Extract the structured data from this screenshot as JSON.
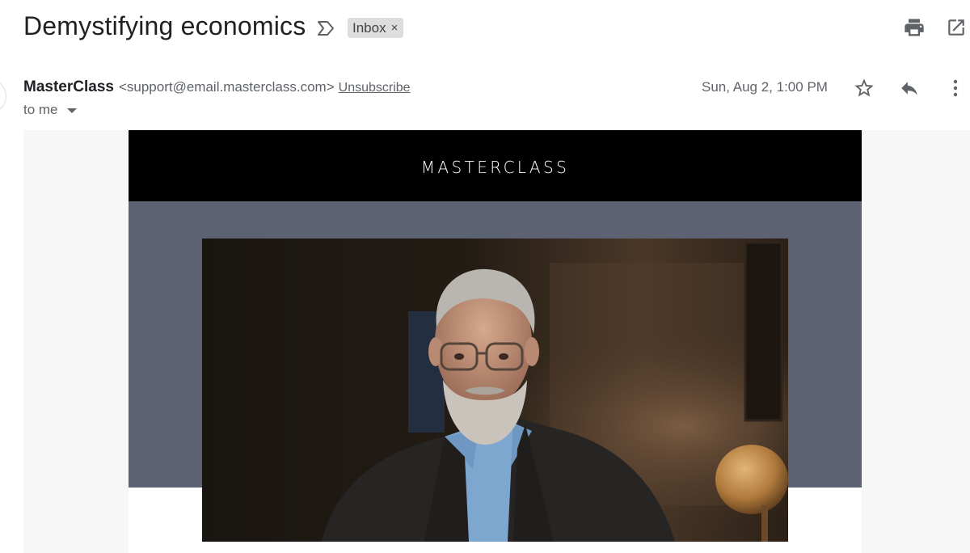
{
  "header": {
    "subject": "Demystifying economics",
    "label": "Inbox",
    "label_remove": "×"
  },
  "message": {
    "sender_name": "MasterClass",
    "sender_email": "<support@email.masterclass.com>",
    "unsubscribe": "Unsubscribe",
    "recipient": "to me",
    "timestamp": "Sun, Aug 2, 1:00 PM"
  },
  "email_body": {
    "brand_logo": "MASTERCLASS"
  },
  "icons": {
    "important": "important-marker-icon",
    "print": "print-icon",
    "popout": "open-in-new-window-icon",
    "star": "star-icon",
    "reply": "reply-icon",
    "more": "more-vertical-icon",
    "recipient_details": "chevron-down-icon"
  },
  "colors": {
    "banner": "#000000",
    "hero_band": "#5d6272",
    "canvas": "#f7f7f7",
    "chip": "#dddddd"
  }
}
